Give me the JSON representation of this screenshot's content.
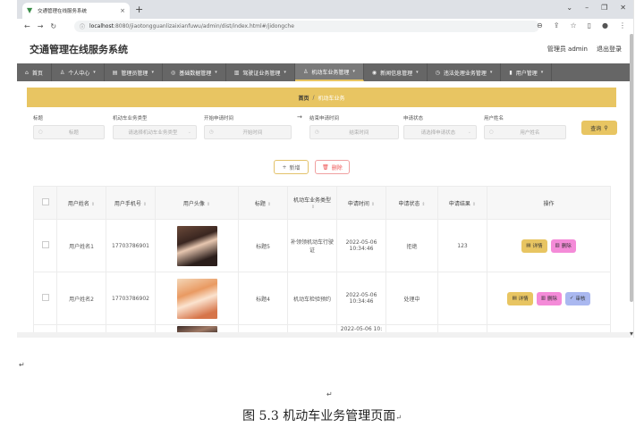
{
  "browser": {
    "tab_title": "交通管理在线服务系统",
    "url_host": "localhost",
    "url_rest": ":8080/jiaotongguanlizaixianfuwu/admin/dist/index.html#/jidongche"
  },
  "app": {
    "title": "交通管理在线服务系统",
    "user_label": "管理员 admin",
    "logout_label": "退出登录"
  },
  "menu": [
    {
      "label": "首页",
      "icon": "home-icon",
      "glyph": "⌂",
      "caret": ""
    },
    {
      "label": "个人中心",
      "icon": "user-icon",
      "glyph": "♙",
      "caret": "▾"
    },
    {
      "label": "管理员管理",
      "icon": "admin-icon",
      "glyph": "▤",
      "caret": "▾"
    },
    {
      "label": "基础数据管理",
      "icon": "pin-icon",
      "glyph": "◎",
      "caret": "▾"
    },
    {
      "label": "驾驶证业务管理",
      "icon": "card-icon",
      "glyph": "▥",
      "caret": "▾"
    },
    {
      "label": "机动车业务管理",
      "icon": "user-icon",
      "glyph": "♙",
      "caret": "▾"
    },
    {
      "label": "新闻信息管理",
      "icon": "pin-icon",
      "glyph": "◉",
      "caret": "▾"
    },
    {
      "label": "违法处理业务管理",
      "icon": "clock-icon",
      "glyph": "◷",
      "caret": "▾"
    },
    {
      "label": "用户管理",
      "icon": "chart-icon",
      "glyph": "▮",
      "caret": "▾"
    }
  ],
  "breadcrumb": {
    "home": "首页",
    "sep": "/",
    "current": "机动车业务"
  },
  "search": {
    "fields": [
      {
        "label": "标题",
        "placeholder": "标题",
        "icon": "search-icon",
        "glyph": "○"
      },
      {
        "label": "机动车业务类型",
        "placeholder": "请选择机动车业务类型",
        "icon": "",
        "glyph": ""
      },
      {
        "label": "开始申请时间",
        "placeholder": "开始时间",
        "icon": "clock-icon",
        "glyph": "◷"
      },
      {
        "label": "结束申请时间",
        "placeholder": "结束时间",
        "icon": "clock-icon",
        "glyph": "◷"
      },
      {
        "label": "申请状态",
        "placeholder": "请选择申请状态",
        "icon": "",
        "glyph": ""
      },
      {
        "label": "用户姓名",
        "placeholder": "用户姓名",
        "icon": "search-icon",
        "glyph": "○"
      }
    ],
    "range_arrow": "→",
    "query_label": "查询"
  },
  "toolbar": {
    "add_label": "新增",
    "delete_label": "删除"
  },
  "table": {
    "columns": [
      "用户姓名",
      "用户手机号",
      "用户头像",
      "标题",
      "机动车业务类型",
      "申请时间",
      "申请状态",
      "申请结果",
      "操作"
    ],
    "rows": [
      {
        "name": "用户姓名1",
        "phone": "17703786901",
        "title": "标题5",
        "type": "补领领机动车行驶证",
        "time": "2022-05-06 10:34:46",
        "status": "拒绝",
        "result": "123",
        "ops": [
          "详情",
          "删除"
        ]
      },
      {
        "name": "用户姓名2",
        "phone": "17703786902",
        "title": "标题4",
        "type": "机动车检验预约",
        "time": "2022-05-06 10:34:46",
        "status": "处理中",
        "result": "",
        "ops": [
          "详情",
          "删除",
          "审核"
        ]
      }
    ],
    "partial_time": "2022-05-06 10:"
  },
  "caption": "图 5.3 机动车业务管理页面"
}
